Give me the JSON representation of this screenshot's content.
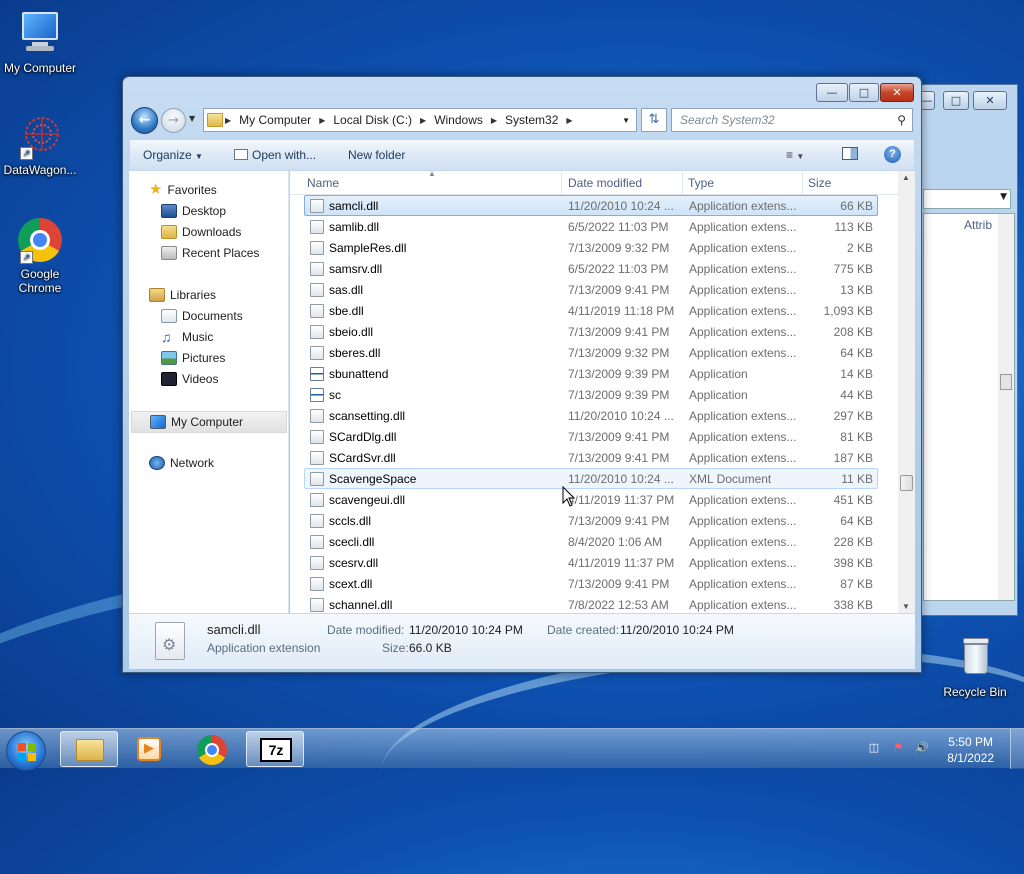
{
  "desktop": {
    "icons": [
      {
        "label": "My Computer",
        "icon": "computer-icon"
      },
      {
        "label": "DataWagon...",
        "icon": "datawagon-icon"
      },
      {
        "label": "Google Chrome",
        "icon": "chrome-icon"
      },
      {
        "label": "Recycle Bin",
        "icon": "recycle-bin-icon"
      }
    ]
  },
  "background_window": {
    "column_label": "Attrib"
  },
  "window": {
    "breadcrumb": [
      "My Computer",
      "Local Disk (C:)",
      "Windows",
      "System32"
    ],
    "search_placeholder": "Search System32",
    "toolbar": {
      "organize": "Organize",
      "open_with": "Open with...",
      "new_folder": "New folder"
    },
    "nav": {
      "favorites": "Favorites",
      "favorites_items": [
        "Desktop",
        "Downloads",
        "Recent Places"
      ],
      "libraries": "Libraries",
      "libraries_items": [
        "Documents",
        "Music",
        "Pictures",
        "Videos"
      ],
      "my_computer": "My Computer",
      "network": "Network"
    },
    "columns": [
      "Name",
      "Date modified",
      "Type",
      "Size"
    ],
    "files": [
      {
        "name": "samcli.dll",
        "date": "11/20/2010 10:24 ...",
        "type": "Application extens...",
        "size": "66 KB",
        "kind": "dll",
        "state": "selected"
      },
      {
        "name": "samlib.dll",
        "date": "6/5/2022 11:03 PM",
        "type": "Application extens...",
        "size": "113 KB",
        "kind": "dll"
      },
      {
        "name": "SampleRes.dll",
        "date": "7/13/2009 9:32 PM",
        "type": "Application extens...",
        "size": "2 KB",
        "kind": "dll"
      },
      {
        "name": "samsrv.dll",
        "date": "6/5/2022 11:03 PM",
        "type": "Application extens...",
        "size": "775 KB",
        "kind": "dll"
      },
      {
        "name": "sas.dll",
        "date": "7/13/2009 9:41 PM",
        "type": "Application extens...",
        "size": "13 KB",
        "kind": "dll"
      },
      {
        "name": "sbe.dll",
        "date": "4/11/2019 11:18 PM",
        "type": "Application extens...",
        "size": "1,093 KB",
        "kind": "dll"
      },
      {
        "name": "sbeio.dll",
        "date": "7/13/2009 9:41 PM",
        "type": "Application extens...",
        "size": "208 KB",
        "kind": "dll"
      },
      {
        "name": "sberes.dll",
        "date": "7/13/2009 9:32 PM",
        "type": "Application extens...",
        "size": "64 KB",
        "kind": "dll"
      },
      {
        "name": "sbunattend",
        "date": "7/13/2009 9:39 PM",
        "type": "Application",
        "size": "14 KB",
        "kind": "exe"
      },
      {
        "name": "sc",
        "date": "7/13/2009 9:39 PM",
        "type": "Application",
        "size": "44 KB",
        "kind": "exe"
      },
      {
        "name": "scansetting.dll",
        "date": "11/20/2010 10:24 ...",
        "type": "Application extens...",
        "size": "297 KB",
        "kind": "dll"
      },
      {
        "name": "SCardDlg.dll",
        "date": "7/13/2009 9:41 PM",
        "type": "Application extens...",
        "size": "81 KB",
        "kind": "dll"
      },
      {
        "name": "SCardSvr.dll",
        "date": "7/13/2009 9:41 PM",
        "type": "Application extens...",
        "size": "187 KB",
        "kind": "dll"
      },
      {
        "name": "ScavengeSpace",
        "date": "11/20/2010 10:24 ...",
        "type": "XML Document",
        "size": "11 KB",
        "kind": "xml",
        "state": "hover"
      },
      {
        "name": "scavengeui.dll",
        "date": "4/11/2019 11:37 PM",
        "type": "Application extens...",
        "size": "451 KB",
        "kind": "dll"
      },
      {
        "name": "sccls.dll",
        "date": "7/13/2009 9:41 PM",
        "type": "Application extens...",
        "size": "64 KB",
        "kind": "dll"
      },
      {
        "name": "scecli.dll",
        "date": "8/4/2020 1:06 AM",
        "type": "Application extens...",
        "size": "228 KB",
        "kind": "dll"
      },
      {
        "name": "scesrv.dll",
        "date": "4/11/2019 11:37 PM",
        "type": "Application extens...",
        "size": "398 KB",
        "kind": "dll"
      },
      {
        "name": "scext.dll",
        "date": "7/13/2009 9:41 PM",
        "type": "Application extens...",
        "size": "87 KB",
        "kind": "dll"
      },
      {
        "name": "schannel.dll",
        "date": "7/8/2022 12:53 AM",
        "type": "Application extens...",
        "size": "338 KB",
        "kind": "dll"
      }
    ],
    "details": {
      "filename": "samcli.dll",
      "type": "Application extension",
      "date_modified_label": "Date modified:",
      "date_modified": "11/20/2010 10:24 PM",
      "date_created_label": "Date created:",
      "date_created": "11/20/2010 10:24 PM",
      "size_label": "Size:",
      "size": "66.0 KB"
    }
  },
  "taskbar": {
    "apps": [
      "explorer-icon",
      "media-player-icon",
      "chrome-icon",
      "7zip-icon"
    ],
    "sevenzip_label": "7z",
    "time": "5:50 PM",
    "date": "8/1/2022"
  }
}
